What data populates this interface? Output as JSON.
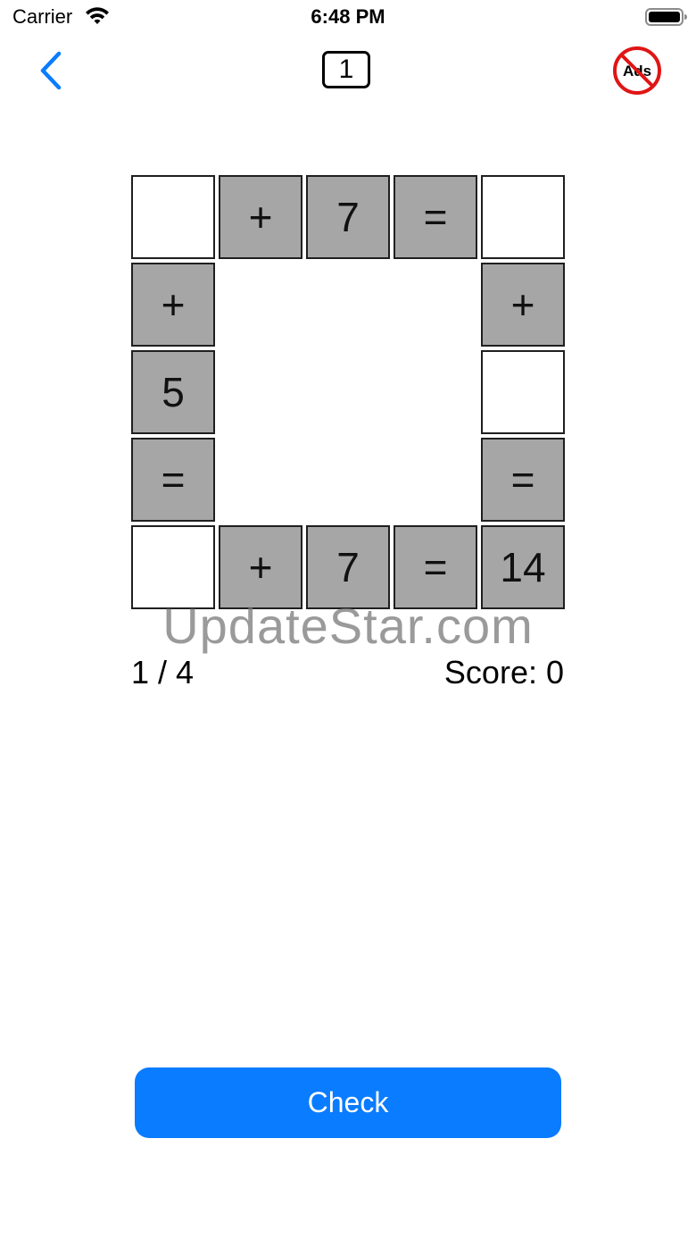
{
  "status_bar": {
    "carrier": "Carrier",
    "time": "6:48 PM"
  },
  "nav": {
    "back_icon": "chevron-left-icon",
    "level": "1",
    "no_ads_icon": "no-ads-icon",
    "no_ads_label": "Ads",
    "accent_color": "#0a7cff"
  },
  "puzzle": {
    "top_row": [
      "",
      "+",
      "7",
      "=",
      ""
    ],
    "left_column": [
      "+",
      "5",
      "="
    ],
    "right_column": [
      "+",
      "",
      "="
    ],
    "bottom_row": [
      "",
      "+",
      "7",
      "=",
      "14"
    ],
    "given_cell_color": "#a6a6a6",
    "empty_cell_color": "#ffffff"
  },
  "watermark": "UpdateStar.com",
  "progress": "1 / 4",
  "score": "Score: 0",
  "check_button": {
    "label": "Check",
    "color": "#0a7cff"
  }
}
